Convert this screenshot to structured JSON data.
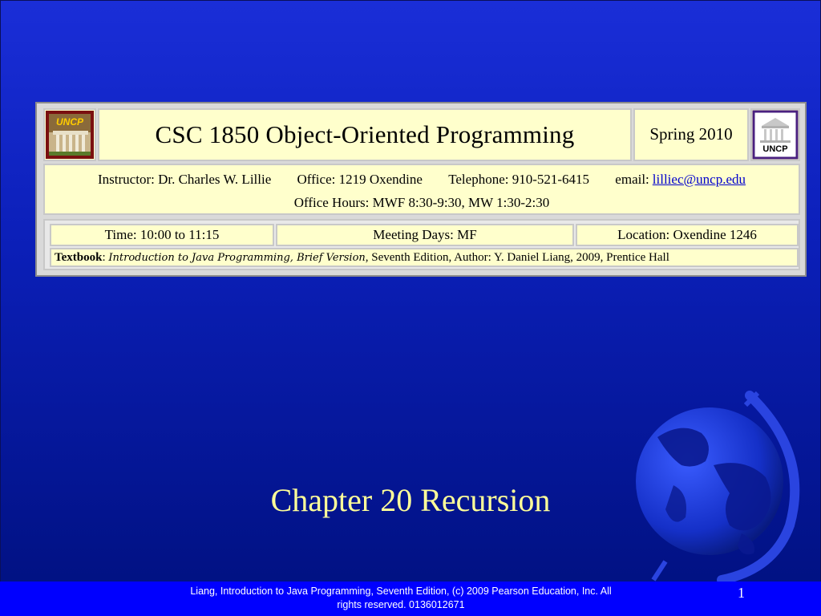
{
  "banner": {
    "left_logo_text": "UNCP",
    "course_title": "CSC 1850 Object-Oriented Programming",
    "term": "Spring 2010",
    "right_logo_text": "UNCP",
    "instructor": "Instructor: Dr. Charles W. Lillie",
    "office": "Office: 1219 Oxendine",
    "telephone": "Telephone: 910-521-6415",
    "email_label": "email:",
    "email": "lilliec@uncp.edu",
    "office_hours": "Office Hours: MWF 8:30-9:30, MW 1:30-2:30",
    "time": "Time: 10:00 to 11:15",
    "meeting_days": "Meeting Days: MF",
    "location": "Location: Oxendine 1246",
    "textbook_label": "Textbook",
    "textbook_title": "Introduction to Java Programming, Brief Version",
    "textbook_rest": ", Seventh Edition, Author: Y. Daniel Liang, 2009, Prentice Hall"
  },
  "slide": {
    "title": "Chapter 20 Recursion"
  },
  "footer": {
    "line1": "Liang, Introduction to Java Programming, Seventh Edition, (c) 2009 Pearson Education, Inc. All",
    "line2": "rights reserved. 0136012671",
    "page_number": "1"
  },
  "colors": {
    "title": "#ffff99",
    "footer_bg": "#0000ff",
    "banner_cell": "#ffffcc"
  },
  "icons": [
    "globe-icon",
    "uncp-logo",
    "uncp-seal"
  ]
}
